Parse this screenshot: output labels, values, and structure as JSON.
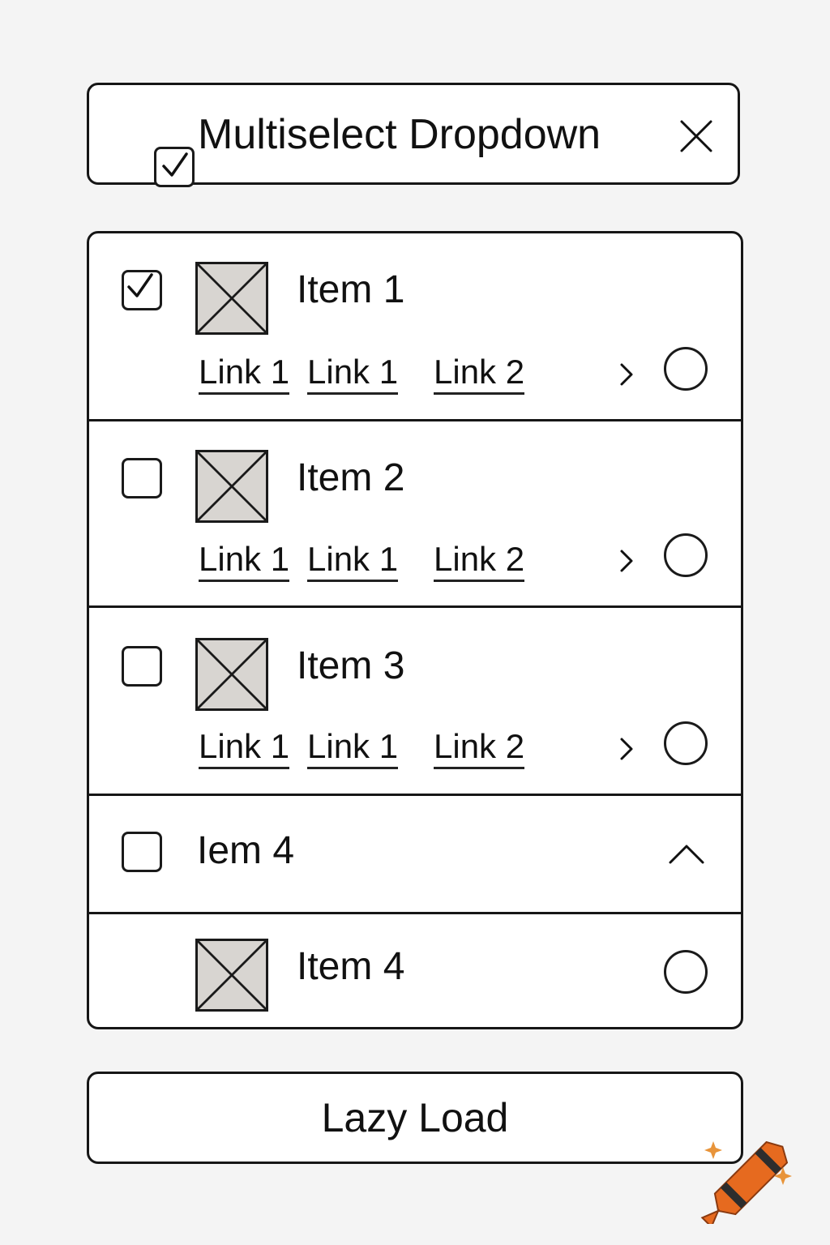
{
  "header": {
    "title": "Multiselect Dropdown",
    "checked": true,
    "close_icon": "close-icon"
  },
  "items": [
    {
      "title": "Item 1",
      "checked": true,
      "links": [
        "Link 1",
        "Link 1",
        "Link 2"
      ]
    },
    {
      "title": "Item 2",
      "checked": false,
      "links": [
        "Link 1",
        "Link 1",
        "Link 2"
      ]
    },
    {
      "title": "Item 3",
      "checked": false,
      "links": [
        "Link 1",
        "Link 1",
        "Link 2"
      ]
    }
  ],
  "group": {
    "title": "Iem 4",
    "checked": false,
    "expanded": true,
    "child": {
      "title": "Item 4"
    }
  },
  "lazy_load": {
    "label": "Lazy Load"
  },
  "colors": {
    "background": "#f4f4f4",
    "surface": "#ffffff",
    "stroke": "#161616",
    "placeholder": "#d8d5d1",
    "crayon": "#e66a1f"
  }
}
